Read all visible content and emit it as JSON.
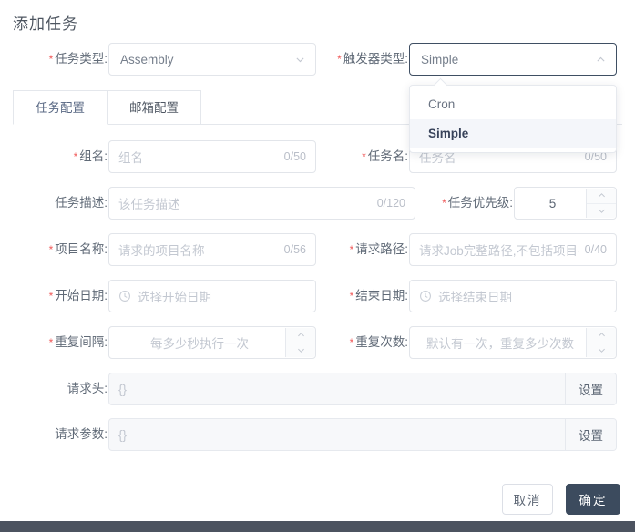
{
  "dialog": {
    "title": "添加任务"
  },
  "header_fields": {
    "task_type": {
      "label": "任务类型",
      "required": true,
      "value": "Assembly",
      "icon": "chevron-down-icon"
    },
    "trigger_type": {
      "label": "触发器类型",
      "required": true,
      "value": "Simple",
      "icon": "chevron-up-icon",
      "expanded": true,
      "options": [
        {
          "label": "Cron",
          "selected": false
        },
        {
          "label": "Simple",
          "selected": true
        }
      ]
    }
  },
  "tabs": [
    {
      "label": "任务配置",
      "active": true
    },
    {
      "label": "邮箱配置",
      "active": false
    }
  ],
  "form": {
    "group_name": {
      "label": "组名",
      "required": true,
      "placeholder": "组名",
      "value": "",
      "counter": "0/50"
    },
    "task_name": {
      "label": "任务名",
      "required": true,
      "placeholder": "任务名",
      "value": "",
      "counter": "0/50"
    },
    "task_desc": {
      "label": "任务描述",
      "required": false,
      "placeholder": "该任务描述",
      "value": "",
      "counter": "0/120"
    },
    "task_priority": {
      "label": "任务优先级",
      "required": true,
      "value": "5",
      "spinner_up": "increment-icon",
      "spinner_down": "decrement-icon"
    },
    "project_name": {
      "label": "项目名称",
      "required": true,
      "placeholder": "请求的项目名称",
      "value": "",
      "counter": "0/56"
    },
    "request_path": {
      "label": "请求路径",
      "required": true,
      "placeholder": "请求Job完整路径,不包括项目名",
      "value": "",
      "counter": "0/40"
    },
    "start_date": {
      "label": "开始日期",
      "required": true,
      "placeholder": "选择开始日期",
      "value": "",
      "icon": "clock-icon"
    },
    "end_date": {
      "label": "结束日期",
      "required": true,
      "placeholder": "选择结束日期",
      "value": "",
      "icon": "clock-icon"
    },
    "repeat_interval": {
      "label": "重复间隔",
      "required": true,
      "placeholder": "每多少秒执行一次",
      "value": ""
    },
    "repeat_count": {
      "label": "重复次数",
      "required": true,
      "placeholder": "默认有一次，重复多少次数",
      "value": ""
    },
    "request_header": {
      "label": "请求头",
      "required": false,
      "value": "{}",
      "action_label": "设置"
    },
    "request_params": {
      "label": "请求参数",
      "required": false,
      "value": "{}",
      "action_label": "设置"
    }
  },
  "footer": {
    "cancel_label": "取消",
    "confirm_label": "确定"
  },
  "colors": {
    "accent_dark": "#3c4b5e",
    "required_star": "#f05a5a",
    "placeholder": "#c3c8d1",
    "border": "#e2e5ea",
    "dropdown_selected_bg": "#f4f6fa",
    "bottom_bar": "#4c5360"
  }
}
